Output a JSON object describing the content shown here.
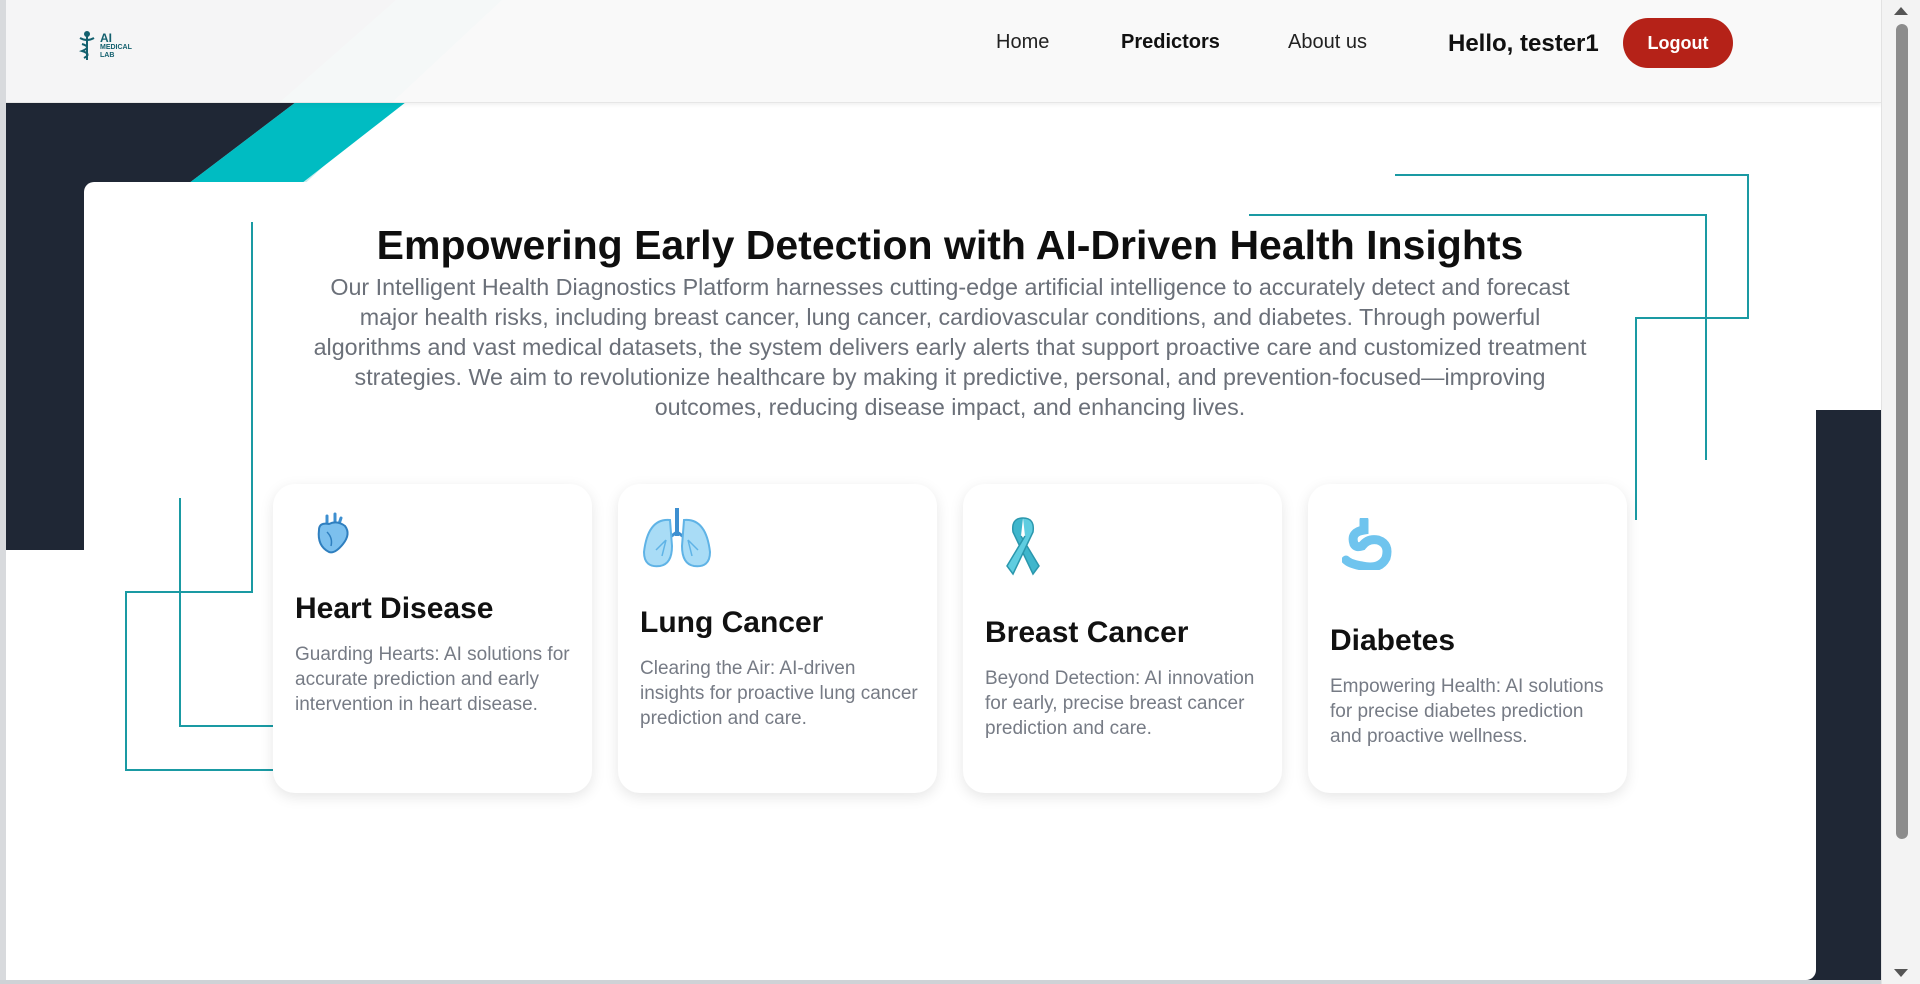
{
  "brand": {
    "logo_text": "AI",
    "logo_sub_1": "MEDICAL",
    "logo_sub_2": "LAB"
  },
  "nav": {
    "items": [
      {
        "label": "Home"
      },
      {
        "label": "Predictors"
      },
      {
        "label": "About us"
      }
    ],
    "greeting": "Hello, tester1",
    "logout_label": "Logout"
  },
  "hero": {
    "title": "Empowering Early Detection with AI-Driven Health Insights",
    "description_lines": [
      "Our Intelligent Health Diagnostics Platform harnesses cutting-edge artificial intelligence to accurately detect and forecast",
      "major health risks, including breast cancer, lung cancer, cardiovascular conditions, and diabetes. Through powerful",
      "algorithms and vast medical datasets, the system delivers early alerts that support proactive care and customized treatment",
      "strategies. We aim to revolutionize healthcare by making it predictive, personal, and prevention-focused—improving",
      "outcomes, reducing disease impact, and enhancing lives."
    ]
  },
  "cards": [
    {
      "title": "Heart Disease",
      "description": "Guarding Hearts: AI solutions for accurate prediction and early intervention in heart disease.",
      "icon": "heart-icon"
    },
    {
      "title": "Lung Cancer",
      "description": "Clearing the Air: AI-driven insights for proactive lung cancer prediction and care.",
      "icon": "lungs-icon"
    },
    {
      "title": "Breast Cancer",
      "description": "Beyond Detection: AI innovation for early, precise breast cancer prediction and care.",
      "icon": "ribbon-icon"
    },
    {
      "title": "Diabetes",
      "description": "Empowering Health: AI solutions for precise diabetes prediction and proactive wellness.",
      "icon": "stomach-icon"
    }
  ],
  "colors": {
    "teal": "#00bcc2",
    "dark_teal": "#00898e",
    "navy": "#1f2735",
    "logout_red": "#b52218",
    "line_teal": "#1a9aa3"
  }
}
